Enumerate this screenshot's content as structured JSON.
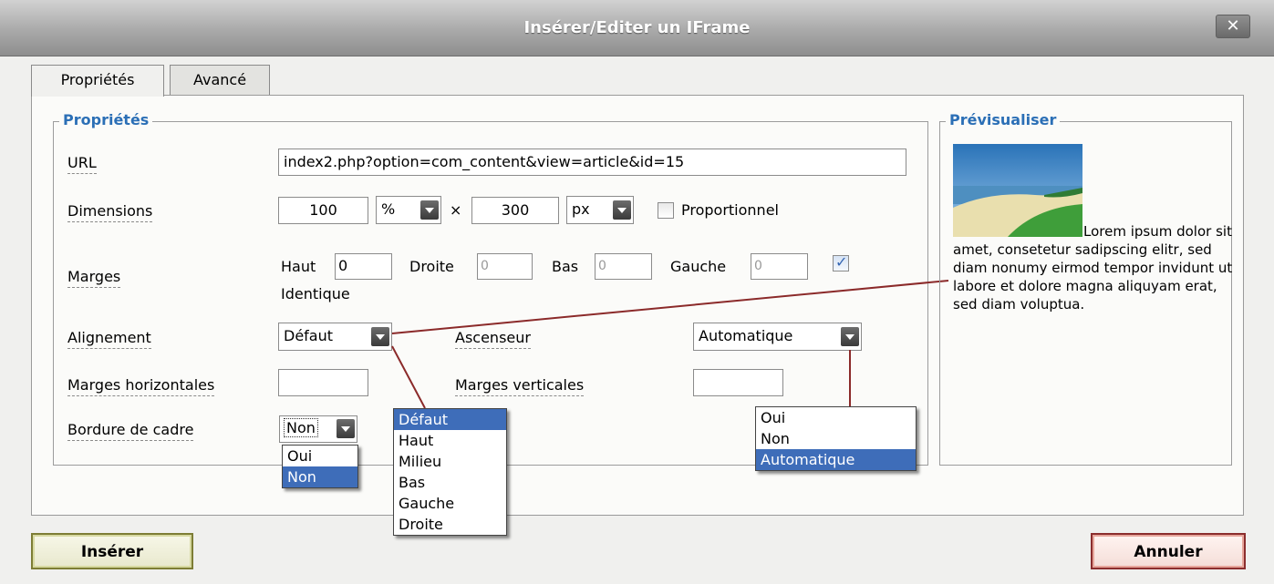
{
  "window": {
    "title": "Insérer/Editer un IFrame",
    "close_label": "✕"
  },
  "tabs": [
    {
      "label": "Propriétés",
      "active": true
    },
    {
      "label": "Avancé",
      "active": false
    }
  ],
  "properties": {
    "legend": "Propriétés",
    "url_label": "URL",
    "url_value": "index2.php?option=com_content&view=article&id=15",
    "dimensions_label": "Dimensions",
    "width_value": "100",
    "width_unit": "%",
    "times": "×",
    "height_value": "300",
    "height_unit": "px",
    "proportional_label": "Proportionnel",
    "proportional_checked": false,
    "margins_label": "Marges",
    "margin_top_label": "Haut",
    "margin_top_value": "0",
    "margin_right_label": "Droite",
    "margin_right_value": "0",
    "margin_bottom_label": "Bas",
    "margin_bottom_value": "0",
    "margin_left_label": "Gauche",
    "margin_left_value": "0",
    "identical_label": "Identique",
    "identical_checked": true,
    "alignment_label": "Alignement",
    "alignment_value": "Défaut",
    "scroll_label": "Ascenseur",
    "scroll_value": "Automatique",
    "hmargins_label": "Marges horizontales",
    "hmargins_value": "",
    "vmargins_label": "Marges verticales",
    "vmargins_value": "",
    "frameborder_label": "Bordure de cadre",
    "frameborder_value": "Non"
  },
  "dropdowns": {
    "frameborder_options": [
      "Oui",
      "Non"
    ],
    "frameborder_selected": "Non",
    "alignment_options": [
      "Défaut",
      "Haut",
      "Milieu",
      "Bas",
      "Gauche",
      "Droite"
    ],
    "alignment_selected": "Défaut",
    "scroll_options": [
      "Oui",
      "Non",
      "Automatique"
    ],
    "scroll_selected": "Automatique"
  },
  "preview": {
    "legend": "Prévisualiser",
    "text": "Lorem ipsum dolor sit amet, consetetur sadipscing elitr, sed diam nonumy eirmod tempor invidunt ut labore et dolore magna aliquyam erat, sed diam voluptua."
  },
  "buttons": {
    "insert": "Insérer",
    "cancel": "Annuler"
  },
  "colors": {
    "accent": "#2b6fb6",
    "selected": "#3e6db9",
    "connector": "#8b2a2a"
  }
}
